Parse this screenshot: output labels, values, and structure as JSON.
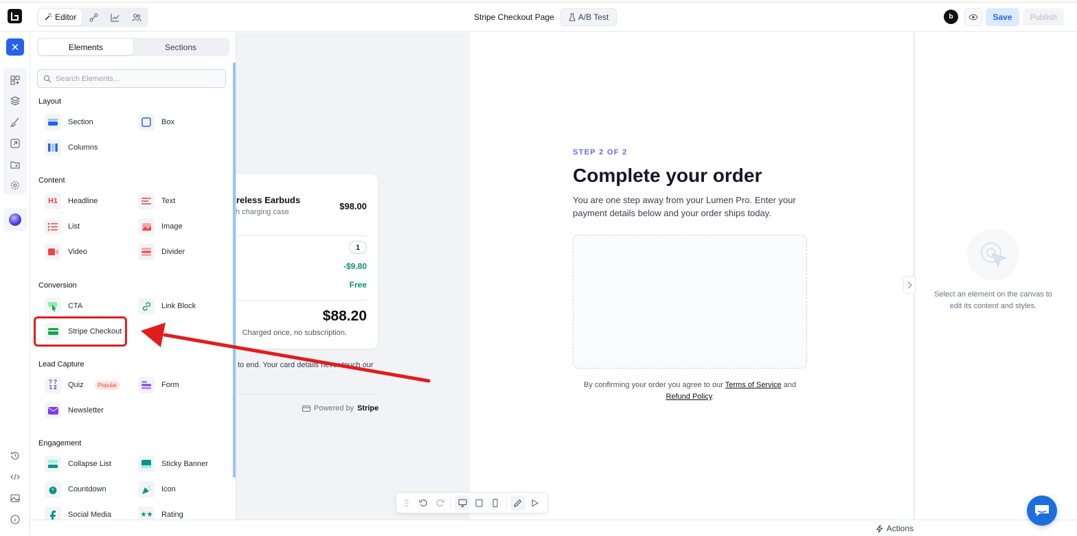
{
  "topbar": {
    "editor_label": "Editor",
    "page_name": "Stripe Checkout Page",
    "ab_test_label": "A/B Test",
    "avatar_initial": "b",
    "save_label": "Save",
    "publish_label": "Publish"
  },
  "panel": {
    "tabs": [
      {
        "label": "Elements"
      },
      {
        "label": "Sections"
      }
    ],
    "search_placeholder": "Search Elements...",
    "categories": {
      "layout": "Layout",
      "content": "Content",
      "conversion": "Conversion",
      "lead_capture": "Lead Capture",
      "engagement": "Engagement"
    },
    "items": {
      "section": "Section",
      "box": "Box",
      "columns": "Columns",
      "headline": "Headline",
      "text": "Text",
      "list": "List",
      "image": "Image",
      "video": "Video",
      "divider": "Divider",
      "cta": "CTA",
      "link_block": "Link Block",
      "stripe_checkout": "Stripe Checkout",
      "quiz": "Quiz",
      "quiz_badge": "Popular",
      "form": "Form",
      "newsletter": "Newsletter",
      "collapse_list": "Collapse List",
      "sticky_banner": "Sticky Banner",
      "countdown": "Countdown",
      "icon": "Icon",
      "social_media": "Social Media",
      "rating": "Rating"
    }
  },
  "canvas": {
    "summary": {
      "item_name": "reless Earbuds",
      "item_sub": "th charging case",
      "item_price": "$98.00",
      "quantity": "1",
      "discount": "-$9.80",
      "shipping": "Free",
      "total": "$88.20",
      "charged_note": "Charged once, no subscription.",
      "secure_note": "to end. Your card details never touch our",
      "powered_by": "Powered by",
      "stripe": "Stripe"
    },
    "main": {
      "step": "STEP 2 OF 2",
      "title": "Complete your order",
      "lead": "You are one step away from your Lumen Pro. Enter your payment details below and your order ships today.",
      "legal_prefix": "By confirming your order you agree to our",
      "terms": "Terms of Service",
      "and": "and",
      "refund": "Refund Policy",
      "period": "."
    }
  },
  "inspector": {
    "empty_text": "Select an element on the canvas to edit its content and styles."
  },
  "bottombar": {
    "actions_label": "Actions"
  },
  "colors": {
    "accent": "#2563eb",
    "step_label": "#6366f1",
    "success": "#059669",
    "annotation": "#e11d1d"
  }
}
